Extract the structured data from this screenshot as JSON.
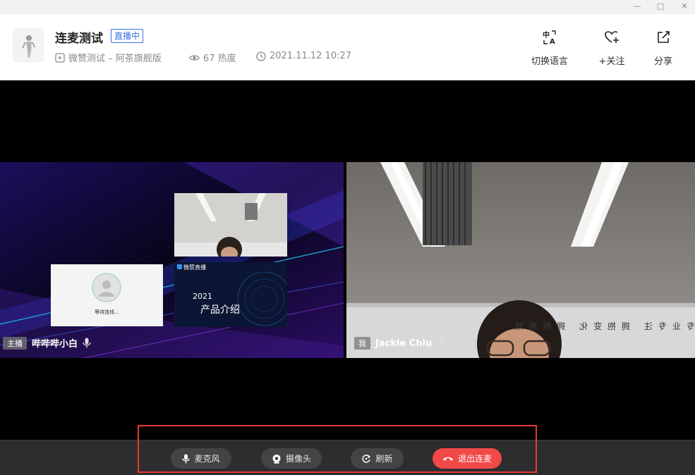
{
  "window": {
    "minimize": "—",
    "maximize": "□",
    "close": "✕"
  },
  "header": {
    "title": "连麦测试",
    "live_badge": "直播中",
    "channel": "微赞测试 – 阿茶旗舰版",
    "heat": "67 热度",
    "time": "2021.11.12 10:27",
    "actions": [
      {
        "label": "切换语言",
        "icon": "translate-icon"
      },
      {
        "label": "+关注",
        "icon": "heart-plus-icon"
      },
      {
        "label": "分享",
        "icon": "share-icon"
      }
    ]
  },
  "video": {
    "left": {
      "role": "主播",
      "name": "哔哔哔小白",
      "waiting_text": "等待连线...",
      "slide_brand": "微赞直播",
      "slide_year": "2021",
      "slide_title": "产品介绍"
    },
    "right": {
      "role": "我",
      "name": "Jackie Chiu",
      "wall_text": "专业专注  拥抱变化  拥抱高效"
    }
  },
  "controls": [
    {
      "label": "麦克风",
      "icon": "microphone-icon"
    },
    {
      "label": "摄像头",
      "icon": "camera-icon"
    },
    {
      "label": "刷新",
      "icon": "refresh-icon"
    },
    {
      "label": "退出连麦",
      "icon": "hangup-icon"
    }
  ],
  "colors": {
    "accent_blue": "#3a6fe0",
    "danger": "#f24848",
    "highlight": "#e53a2f"
  }
}
